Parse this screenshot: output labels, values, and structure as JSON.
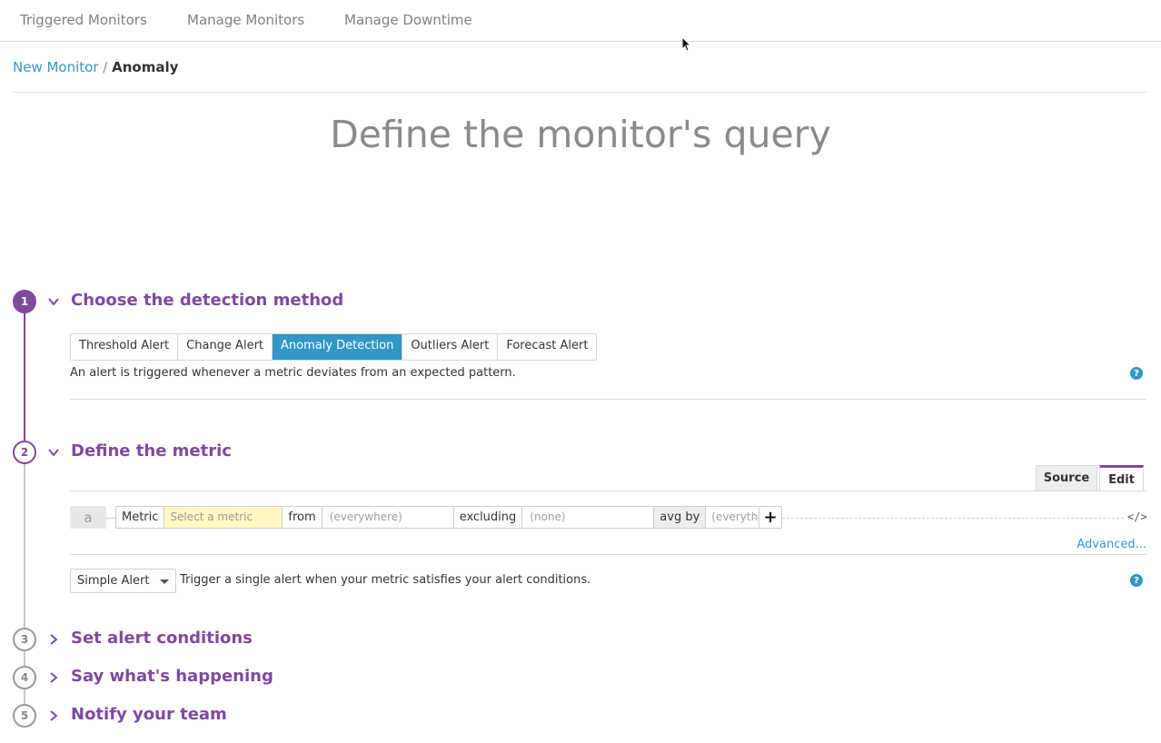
{
  "topnav": {
    "items": [
      {
        "label": "Triggered Monitors"
      },
      {
        "label": "Manage Monitors"
      },
      {
        "label": "Manage Downtime"
      }
    ]
  },
  "breadcrumb": {
    "parent": "New Monitor",
    "separator": "/",
    "current": "Anomaly"
  },
  "page_title": "Define the monitor's query",
  "steps": [
    {
      "number": "1",
      "title": "Choose the detection method"
    },
    {
      "number": "2",
      "title": "Define the metric"
    },
    {
      "number": "3",
      "title": "Set alert conditions"
    },
    {
      "number": "4",
      "title": "Say what's happening"
    },
    {
      "number": "5",
      "title": "Notify your team"
    }
  ],
  "detection": {
    "tabs": [
      {
        "label": "Threshold Alert"
      },
      {
        "label": "Change Alert"
      },
      {
        "label": "Anomaly Detection"
      },
      {
        "label": "Outliers Alert"
      },
      {
        "label": "Forecast Alert"
      }
    ],
    "selected": "Anomaly Detection",
    "description": "An alert is triggered whenever a metric deviates from an expected pattern."
  },
  "metric": {
    "source_tab": "Source",
    "edit_tab": "Edit",
    "query_letter": "a",
    "metric_label": "Metric",
    "metric_placeholder": "Select a metric",
    "from_label": "from",
    "from_placeholder": "(everywhere)",
    "excluding_label": "excluding",
    "excluding_placeholder": "(none)",
    "avg_label": "avg by",
    "avg_placeholder": "(everything)",
    "add_symbol": "+",
    "code_symbol": "</>",
    "advanced_link": "Advanced...",
    "alert_type": "Simple Alert",
    "alert_description": "Trigger a single alert when your metric satisfies your alert conditions."
  },
  "help_symbol": "?",
  "colors": {
    "accent_purple": "#7e4a9e",
    "link_blue": "#3197c9",
    "metric_highlight": "#fff8c4"
  }
}
